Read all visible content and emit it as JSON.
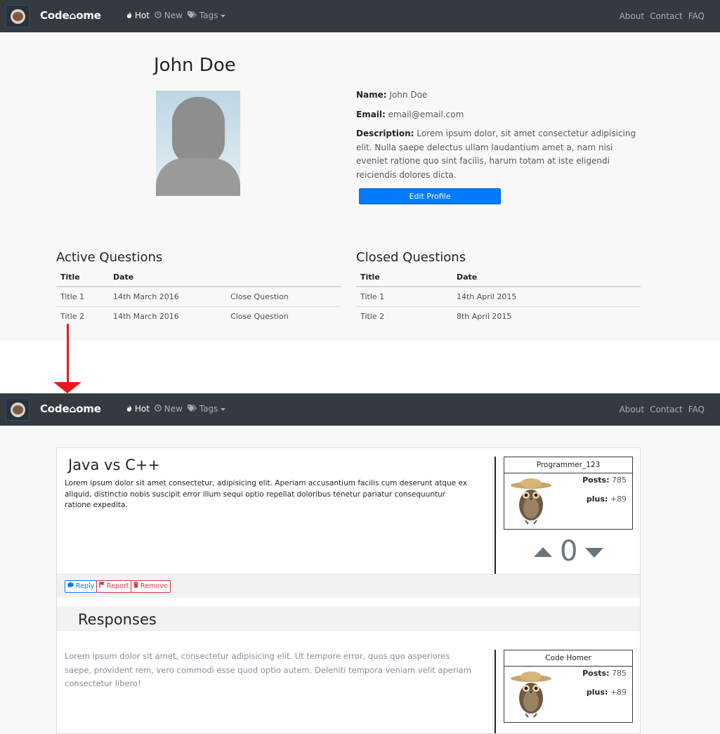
{
  "nav": {
    "brand_left": "Code",
    "brand_house": "⌂",
    "brand_right": "ome",
    "links": {
      "hot": "Hot",
      "new": "New",
      "tags": "Tags"
    },
    "right": {
      "about": "About",
      "contact": "Contact",
      "faq": "FAQ"
    },
    "icons": {
      "hot": "fire-icon",
      "new": "clock-icon",
      "tags": "tags-icon",
      "dropdown": "caret-down-icon"
    }
  },
  "profile": {
    "name": "John Doe",
    "name_label": "Name:",
    "name_value": "John Doe",
    "email_label": "Email:",
    "email_value": "email@email.com",
    "description_label": "Description:",
    "description_value": "Lorem ipsum dolor, sit amet consectetur adipisicing elit. Nulla saepe delectus ullam laudantium amet a, nam nisi eveniet ratione quo sint facilis, harum totam at iste eligendi reiciendis dolores dicta.",
    "edit_button": "Edit Profile"
  },
  "active_questions": {
    "title": "Active Questions",
    "headers": [
      "Title",
      "Date",
      ""
    ],
    "rows": [
      [
        "Title 1",
        "14th March 2016",
        "Close Question"
      ],
      [
        "Title 2",
        "14th March 2016",
        "Close Question"
      ]
    ]
  },
  "closed_questions": {
    "title": "Closed Questions",
    "headers": [
      "Title",
      "Date"
    ],
    "rows": [
      [
        "Title 1",
        "14th April 2015"
      ],
      [
        "Title 2",
        "8th April 2015"
      ]
    ]
  },
  "question": {
    "title": "Java vs C++",
    "body": "Lorem ipsum dolor sit amet consectetur, adipisicing elit. Aperiam accusantium facilis cum deserunt atque ex aliquid, distinctio nobis suscipit error illum sequi optio repellat doloribus tenetur pariatur consequuntur ratione expedita.",
    "author": {
      "username": "Programmer_123",
      "posts_label": "Posts:",
      "posts": "785",
      "plus_label": "plus:",
      "plus": "+89"
    },
    "votes": "0",
    "actions": {
      "reply": "Reply",
      "report": "Report",
      "remove": "Remove"
    }
  },
  "responses": {
    "title": "Responses",
    "items": [
      {
        "body": "Lorem ipsum dolor sit amet, consectetur adipisicing elit. Ut tempore error, quos quo asperiores saepe, provident rem, vero commodi esse quod optio autem. Deleniti tempora veniam velit aperiam consectetur libero!",
        "author": {
          "username": "Code Homer",
          "posts_label": "Posts:",
          "posts": "785",
          "plus_label": "plus:",
          "plus": "+89"
        }
      }
    ]
  },
  "colors": {
    "navbar": "#343a40",
    "primary": "#007bff",
    "danger": "#dc3545",
    "arrow": "#e8171c",
    "vote": "#6c757d"
  }
}
